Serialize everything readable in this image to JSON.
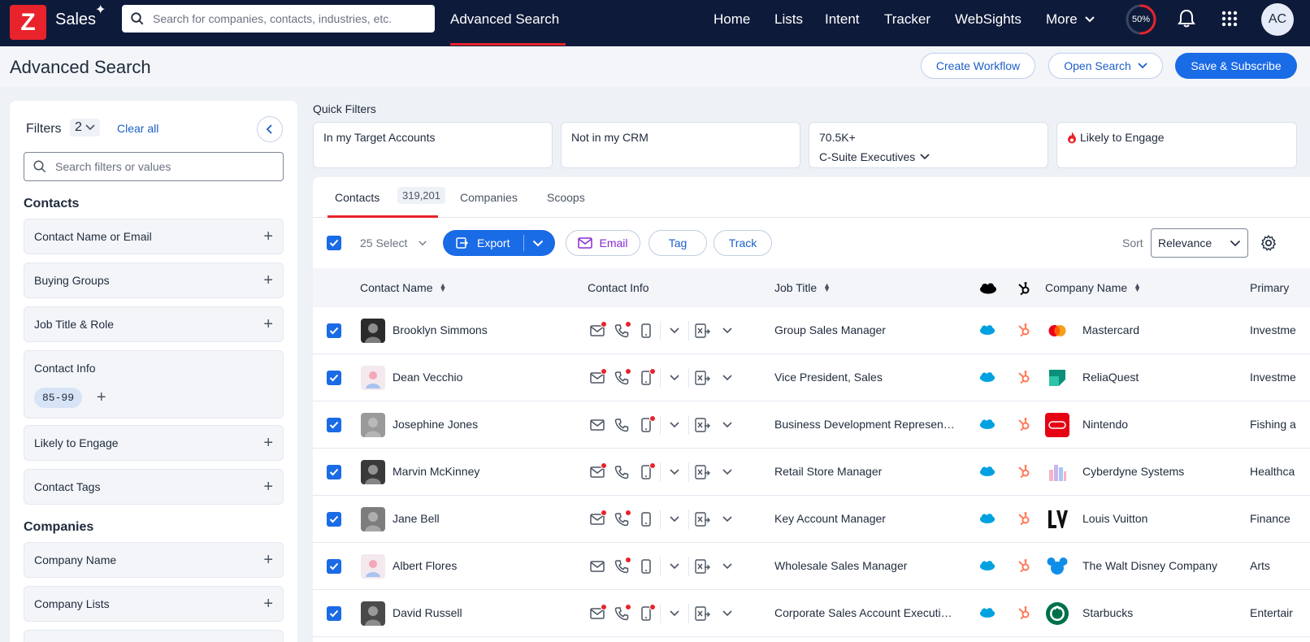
{
  "topnav": {
    "brand": "Sales",
    "search_placeholder": "Search for companies, contacts, industries, etc.",
    "active_link": "Advanced Search",
    "links": [
      "Home",
      "Lists",
      "Intent",
      "Tracker",
      "WebSights",
      "More"
    ],
    "progress_label": "50%",
    "progress_value": 0.5,
    "avatar_initials": "AC",
    "accent_color": "#e8232b"
  },
  "header": {
    "title": "Advanced Search",
    "create_workflow": "Create Workflow",
    "open_search": "Open Search",
    "save_subscribe": "Save & Subscribe"
  },
  "filters": {
    "label": "Filters",
    "count": "2",
    "clear_all": "Clear all",
    "search_placeholder": "Search filters or values",
    "contacts_title": "Contacts",
    "contact_name": "Contact Name or Email",
    "buying_groups": "Buying Groups",
    "job_title": "Job Title & Role",
    "contact_info": "Contact Info",
    "contact_info_chip": "85-99",
    "likely_engage": "Likely to Engage",
    "contact_tags": "Contact Tags",
    "companies_title": "Companies",
    "company_name": "Company Name",
    "company_lists": "Company Lists"
  },
  "quick_filters": {
    "label": "Quick Filters",
    "cards": [
      {
        "title": "In my Target Accounts"
      },
      {
        "title": "Not in my CRM"
      },
      {
        "title": "70.5K+",
        "sub": "C-Suite Executives"
      },
      {
        "title": "Likely to Engage"
      }
    ]
  },
  "tabs": {
    "contacts": "Contacts",
    "contacts_count": "319,201",
    "companies": "Companies",
    "scoops": "Scoops"
  },
  "toolbar": {
    "select": "25 Select",
    "export": "Export",
    "email": "Email",
    "tag": "Tag",
    "track": "Track",
    "sort_label": "Sort",
    "sort_value": "Relevance"
  },
  "columns": {
    "contact_name": "Contact Name",
    "contact_info": "Contact Info",
    "job_title": "Job Title",
    "company_name": "Company Name",
    "primary": "Primary"
  },
  "rows": [
    {
      "name": "Brooklyn Simmons",
      "job": "Group Sales Manager",
      "company": "Mastercard",
      "industry": "Investme"
    },
    {
      "name": "Dean Vecchio",
      "job": "Vice President, Sales",
      "company": "ReliaQuest",
      "industry": "Investme"
    },
    {
      "name": "Josephine Jones",
      "job": "Business Development Represen…",
      "company": "Nintendo",
      "industry": "Fishing a"
    },
    {
      "name": "Marvin McKinney",
      "job": "Retail Store Manager",
      "company": "Cyberdyne Systems",
      "industry": "Healthca"
    },
    {
      "name": "Jane Bell",
      "job": "Key Account Manager",
      "company": "Louis Vuitton",
      "industry": "Finance"
    },
    {
      "name": "Albert Flores",
      "job": "Wholesale Sales Manager",
      "company": "The Walt Disney Company",
      "industry": "Arts"
    },
    {
      "name": "David Russell",
      "job": "Corporate Sales Account Executi…",
      "company": "Starbucks",
      "industry": "Entertair"
    }
  ]
}
